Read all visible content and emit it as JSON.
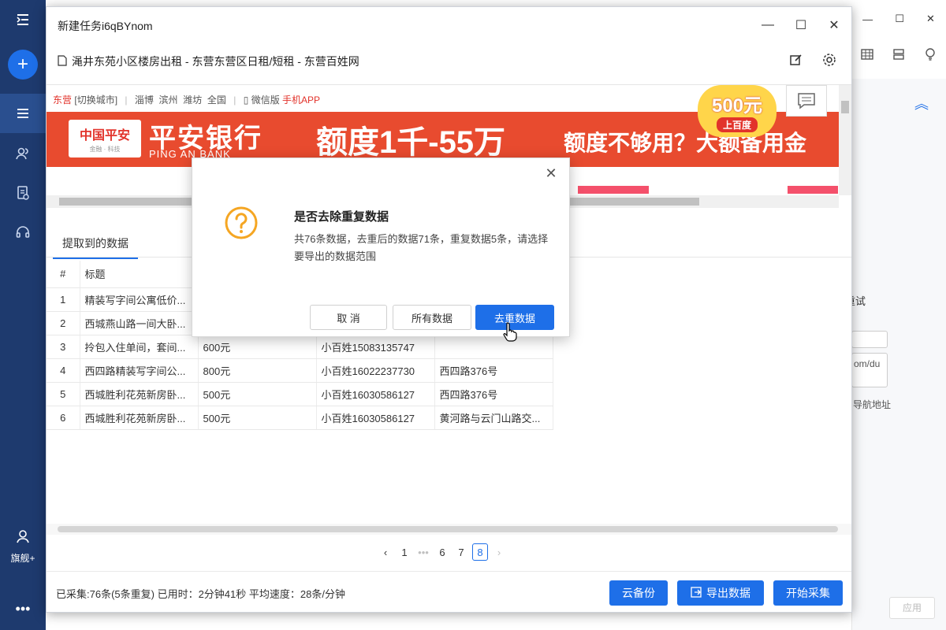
{
  "sidebar": {
    "vip_label": "旗舰+"
  },
  "background_app": {
    "retry_label": "重试",
    "nav_address_label": "为导航地址",
    "url_fragment": "om/du",
    "apply_label": "应用"
  },
  "window": {
    "title": "新建任务i6qBYnom",
    "url_title": "渑井东苑小区楼房出租 - 东营东营区日租/短租 - 东营百姓网"
  },
  "webpage": {
    "nav": {
      "city": "东营",
      "switch_city": "[切换城市]",
      "cities": [
        "淄博",
        "滨州",
        "潍坊",
        "全国"
      ],
      "wechat": "微信版",
      "app": "手机APP"
    },
    "banner": {
      "logo_text": "中国平安",
      "logo_sub": "金融 · 科技",
      "bank_name_cn": "平安银行",
      "bank_name_en": "PING AN BANK",
      "headline": "额度1千-55万",
      "subline": "额度不够用？大额备用金",
      "badge_amount": "500元",
      "badge_sub": "上百度"
    }
  },
  "tabs": {
    "active": "提取到的数据"
  },
  "table": {
    "headers": [
      "#",
      "标题",
      "",
      "",
      ""
    ],
    "rows": [
      [
        "1",
        "精装写字间公寓低价...",
        "",
        "",
        ""
      ],
      [
        "2",
        "西城燕山路一间大卧...",
        "",
        "",
        ""
      ],
      [
        "3",
        "拎包入住单间，套间...",
        "600元",
        "小百姓15083135747",
        ""
      ],
      [
        "4",
        "西四路精装写字间公...",
        "800元",
        "小百姓16022237730",
        "西四路376号"
      ],
      [
        "5",
        "西城胜利花苑新房卧...",
        "500元",
        "小百姓16030586127",
        "西四路376号"
      ],
      [
        "6",
        "西城胜利花苑新房卧...",
        "500元",
        "小百姓16030586127",
        "黄河路与云门山路交..."
      ]
    ]
  },
  "pagination": {
    "pages": [
      "1",
      "•••",
      "6",
      "7",
      "8"
    ],
    "current": "8"
  },
  "footer": {
    "status": "已采集:76条(5条重复) 已用时：2分钟41秒 平均速度：28条/分钟",
    "cloud_backup": "云备份",
    "export": "导出数据",
    "start": "开始采集"
  },
  "dialog": {
    "title": "是否去除重复数据",
    "message": "共76条数据，去重后的数据71条，重复数据5条，请选择要导出的数据范围",
    "cancel": "取 消",
    "all_data": "所有数据",
    "dedupe_data": "去重数据"
  },
  "colors": {
    "primary": "#1e6fe8",
    "sidebar": "#1e3a6e",
    "warning": "#f5a623",
    "banner": "#e84b2f"
  }
}
